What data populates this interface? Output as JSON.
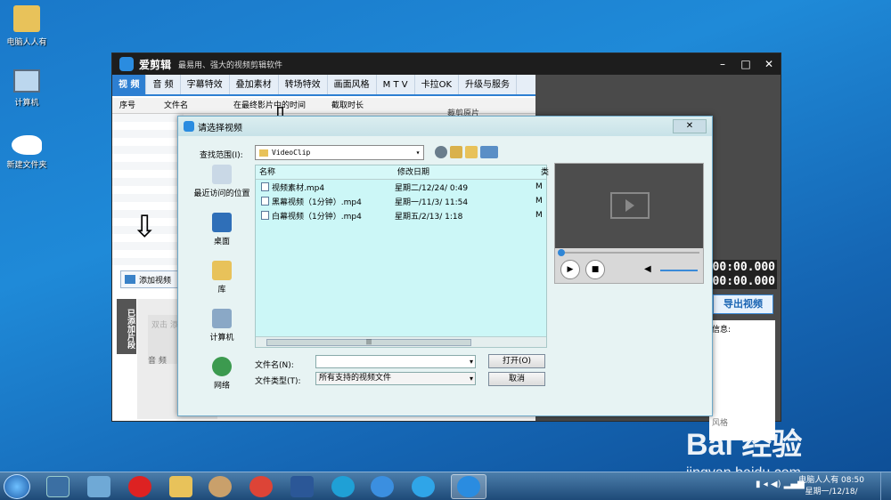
{
  "desktop": {
    "icons": [
      {
        "label": "电脑人人有"
      },
      {
        "label": "计算机"
      },
      {
        "label": "新建文件夹"
      }
    ]
  },
  "app": {
    "name": "爱剪辑",
    "slogan": "最易用、强大的视频剪辑软件",
    "tabs": [
      "视 频",
      "音 频",
      "字幕特效",
      "叠加素材",
      "转场特效",
      "画面风格",
      "M T V",
      "卡拉OK",
      "升级与服务"
    ],
    "columns": [
      "序号",
      "文件名",
      "在最终影片中的时间",
      "截取时长"
    ],
    "clip_header": "裁剪原片",
    "add_video_label": "添加视频",
    "added_clips_tab": "已添加片段",
    "placeholder_text": "双击\n添加",
    "audio_label": "音 频",
    "time_1": "00:00.000",
    "time_2": "00:00.000",
    "export_label": "导出视频",
    "info_label": "信息:",
    "info_footer": "风格"
  },
  "dialog": {
    "title": "请选择视频",
    "look_in_label": "查找范围(I):",
    "current_folder": "VideoClip",
    "places": [
      "最近访问的位置",
      "桌面",
      "库",
      "计算机",
      "网络"
    ],
    "columns": [
      "名称",
      "修改日期",
      "类"
    ],
    "files": [
      {
        "name": "视频素材.mp4",
        "date": "星期二/12/24/ 0:49",
        "type": "M"
      },
      {
        "name": "黑幕视频（1分钟）.mp4",
        "date": "星期一/11/3/ 11:54",
        "type": "M"
      },
      {
        "name": "白幕视频（1分钟）.mp4",
        "date": "星期五/2/13/ 1:18",
        "type": "M"
      }
    ],
    "filename_label": "文件名(N):",
    "filename_value": "",
    "filetype_label": "文件类型(T):",
    "filetype_value": "所有支持的视频文件",
    "open_label": "打开(O)",
    "cancel_label": "取消"
  },
  "taskbar": {
    "clock_line1": "电脑人人有 08:50",
    "clock_line2": "星期一/12/18/"
  },
  "watermark": {
    "logo": "Bai 经验",
    "url": "jingyan.baidu.com"
  },
  "colors": {
    "accent": "#2d7fd2",
    "dialog_list_bg": "#ccf7f7",
    "app_titlebar": "#1d1d1d"
  }
}
